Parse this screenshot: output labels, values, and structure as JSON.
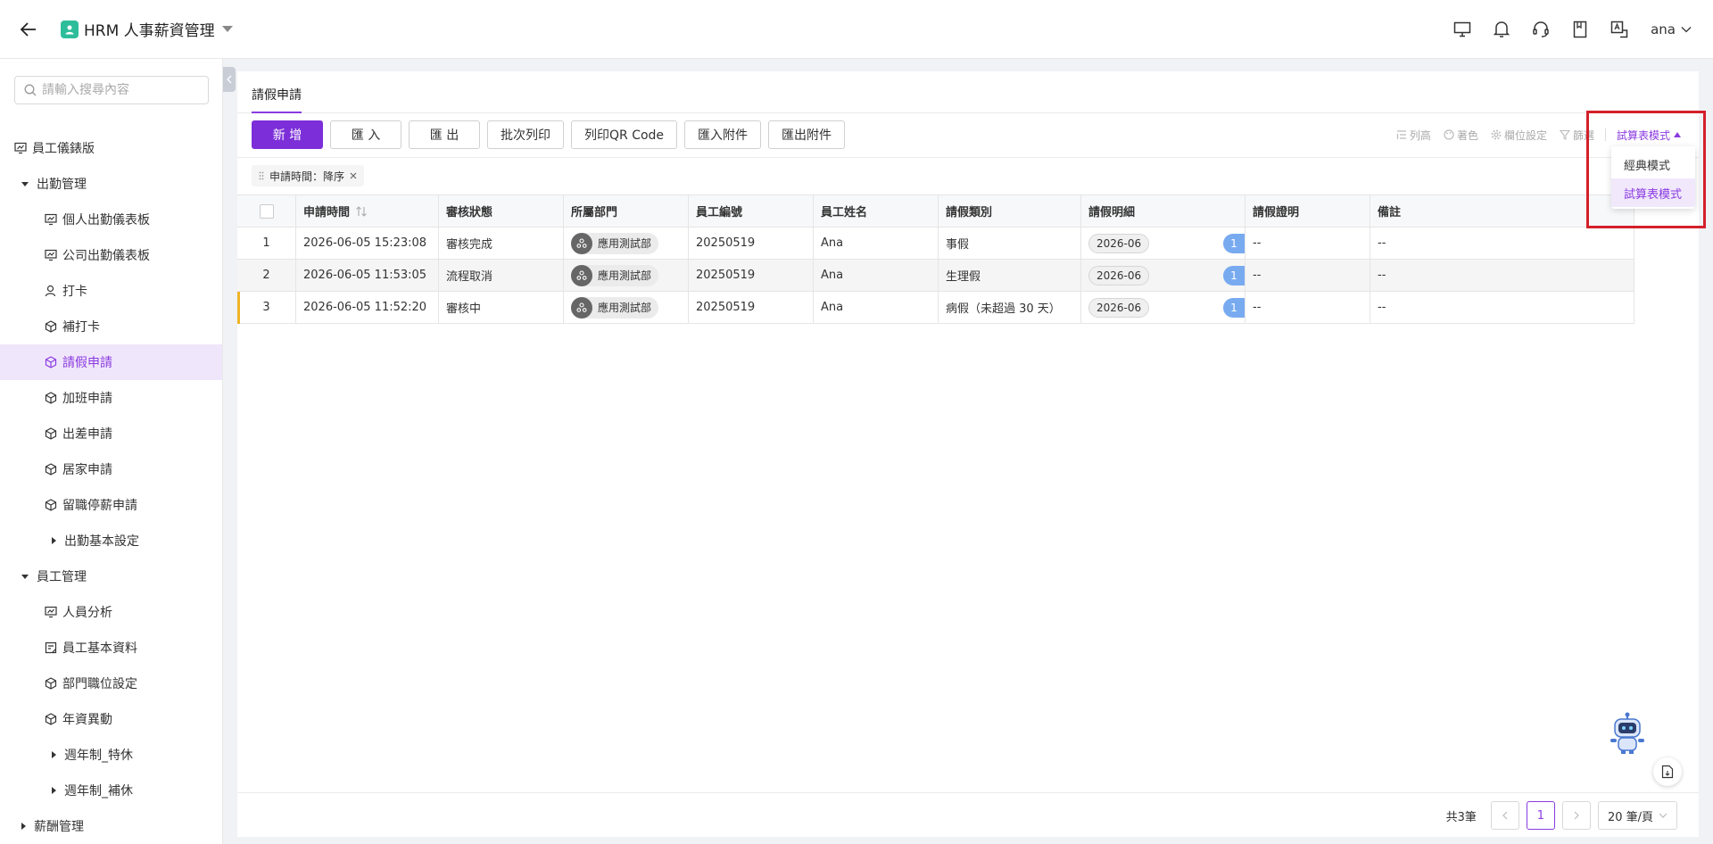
{
  "header": {
    "app_title": "HRM 人事薪資管理",
    "user": "ana",
    "icons": [
      "back-icon",
      "monitor-icon",
      "bell-icon",
      "headset-icon",
      "book-icon",
      "translate-icon"
    ]
  },
  "sidebar": {
    "search_placeholder": "請輸入搜尋內容",
    "items": [
      {
        "label": "員工儀錶版",
        "icon": "dashboard-icon"
      },
      {
        "label": "出勤管理",
        "icon": "caret-down-icon"
      },
      {
        "label": "個人出勤儀表板",
        "icon": "dashboard-icon"
      },
      {
        "label": "公司出勤儀表板",
        "icon": "dashboard-icon"
      },
      {
        "label": "打卡",
        "icon": "user-icon"
      },
      {
        "label": "補打卡",
        "icon": "cube-icon"
      },
      {
        "label": "請假申請",
        "icon": "cube-icon",
        "active": true
      },
      {
        "label": "加班申請",
        "icon": "cube-icon"
      },
      {
        "label": "出差申請",
        "icon": "cube-icon"
      },
      {
        "label": "居家申請",
        "icon": "cube-icon"
      },
      {
        "label": "留職停薪申請",
        "icon": "cube-icon"
      },
      {
        "label": "出勤基本設定",
        "icon": "caret-right-icon"
      },
      {
        "label": "員工管理",
        "icon": "caret-down-icon"
      },
      {
        "label": "人員分析",
        "icon": "dashboard-icon"
      },
      {
        "label": "員工基本資料",
        "icon": "form-icon"
      },
      {
        "label": "部門職位設定",
        "icon": "cube-icon"
      },
      {
        "label": "年資異動",
        "icon": "cube-icon"
      },
      {
        "label": "週年制_特休",
        "icon": "caret-right-icon"
      },
      {
        "label": "週年制_補休",
        "icon": "caret-right-icon"
      },
      {
        "label": "薪酬管理",
        "icon": "caret-right-icon"
      }
    ]
  },
  "tab": {
    "label": "請假申請"
  },
  "toolbar": {
    "buttons": [
      "新 增",
      "匯 入",
      "匯 出",
      "批次列印",
      "列印QR Code",
      "匯入附件",
      "匯出附件"
    ],
    "right": {
      "row_height": "列高",
      "color": "著色",
      "column_settings": "欄位設定",
      "filter": "篩選",
      "mode": "試算表模式"
    }
  },
  "sort_chip": {
    "label": "申請時間：降序"
  },
  "table": {
    "columns": [
      "申請時間",
      "審核狀態",
      "所屬部門",
      "員工編號",
      "員工姓名",
      "請假類別",
      "請假明細",
      "請假證明",
      "備註"
    ],
    "rows": [
      {
        "no": "1",
        "time": "2026-06-05 15:23:08",
        "status": "審核完成",
        "dept": "應用測試部",
        "emp_id": "20250519",
        "name": "Ana",
        "type": "事假",
        "detail": "2026-06",
        "count": "1",
        "proof": "--",
        "note": "--"
      },
      {
        "no": "2",
        "time": "2026-06-05 11:53:05",
        "status": "流程取消",
        "dept": "應用測試部",
        "emp_id": "20250519",
        "name": "Ana",
        "type": "生理假",
        "detail": "2026-06",
        "count": "1",
        "proof": "--",
        "note": "--"
      },
      {
        "no": "3",
        "time": "2026-06-05 11:52:20",
        "status": "審核中",
        "dept": "應用測試部",
        "emp_id": "20250519",
        "name": "Ana",
        "type": "病假（未超過 30 天）",
        "detail": "2026-06",
        "count": "1",
        "proof": "--",
        "note": "--"
      }
    ]
  },
  "mode_menu": {
    "options": [
      "經典模式",
      "試算表模式"
    ],
    "selected": "試算表模式"
  },
  "pagination": {
    "total": "共3筆",
    "current_page": "1",
    "page_size": "20 筆/頁"
  },
  "colors": {
    "accent": "#8a3be0",
    "primary_button": "#7c2fd9",
    "highlight_border": "#d4202a",
    "count_badge": "#78aaf0",
    "row_marker": "#f0b429"
  }
}
